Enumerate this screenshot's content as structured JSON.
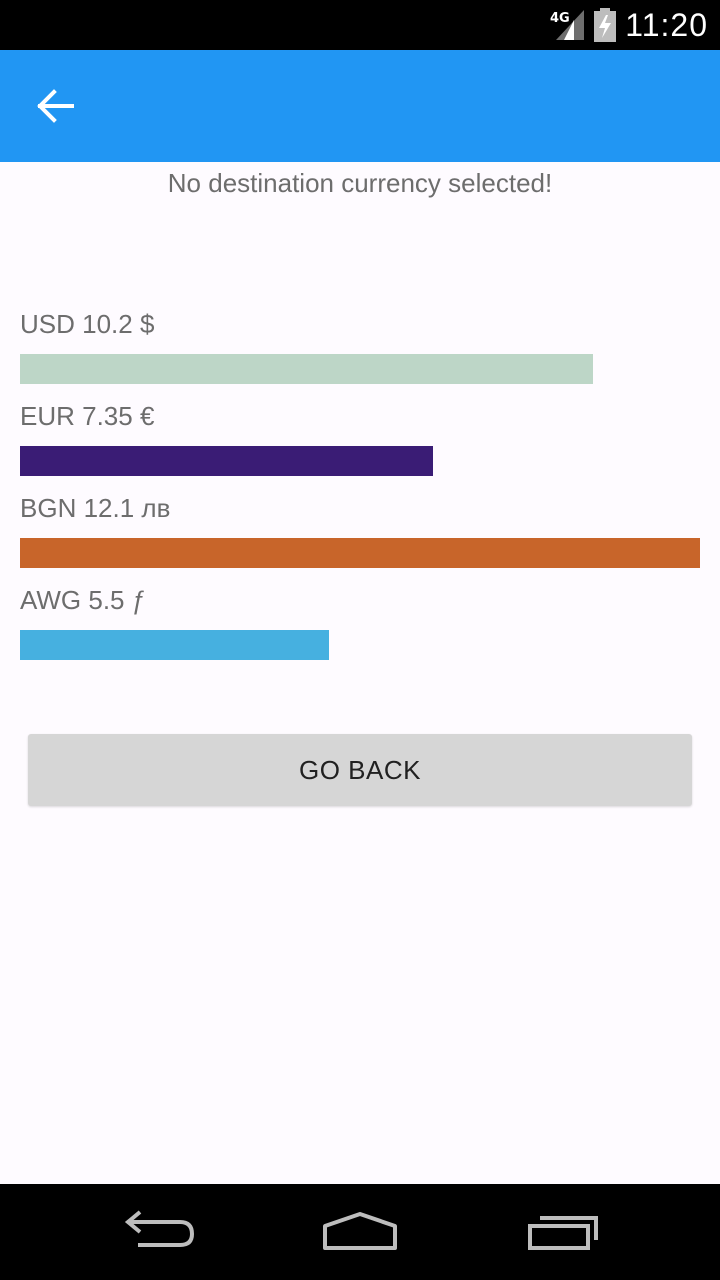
{
  "status_bar": {
    "network": "4G",
    "time": "11:20",
    "icons": [
      "signal-icon",
      "battery-charging-icon"
    ]
  },
  "app_bar": {
    "color": "#2196f3",
    "back_icon": "arrow-left-icon"
  },
  "message": "No destination currency selected!",
  "currencies": [
    {
      "code": "USD",
      "value": 10.2,
      "symbol": "$",
      "label": "USD 10.2 $",
      "color": "#bdd6c7"
    },
    {
      "code": "EUR",
      "value": 7.35,
      "symbol": "€",
      "label": "EUR 7.35 €",
      "color": "#3a1c75"
    },
    {
      "code": "BGN",
      "value": 12.1,
      "symbol": "лв",
      "label": "BGN 12.1 лв",
      "color": "#c8652a"
    },
    {
      "code": "AWG",
      "value": 5.5,
      "symbol": "ƒ",
      "label": "AWG 5.5 ƒ",
      "color": "#46b0e0"
    }
  ],
  "go_back_label": "GO BACK",
  "nav_bar": {
    "icons": [
      "nav-back-icon",
      "nav-home-icon",
      "nav-recents-icon"
    ]
  }
}
